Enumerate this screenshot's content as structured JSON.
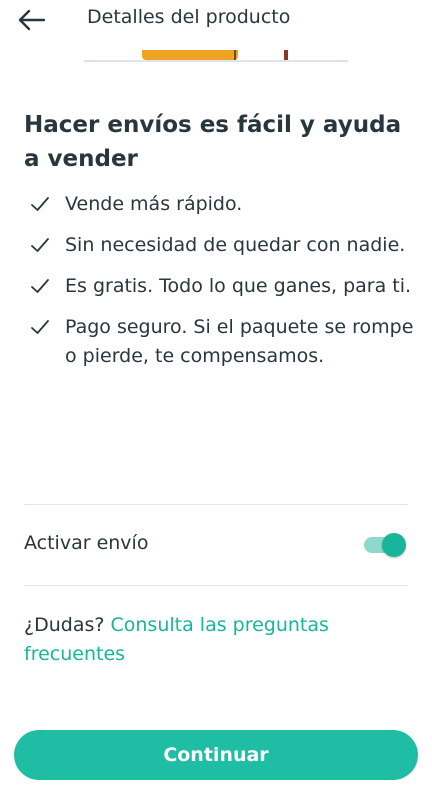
{
  "header": {
    "title": "Detalles del producto",
    "back_icon": "arrow-left-icon"
  },
  "main": {
    "heading": "Hacer envíos es fácil y ayuda a vender",
    "benefits": [
      {
        "icon": "check-icon",
        "text": "Vende más rápido."
      },
      {
        "icon": "check-icon",
        "text": "Sin necesidad de quedar con nadie."
      },
      {
        "icon": "check-icon",
        "text": "Es gratis. Todo lo que ganes, para ti."
      },
      {
        "icon": "check-icon",
        "text": "Pago seguro. Si el paquete se rompe o pierde, te compensamos."
      }
    ],
    "shipping_toggle": {
      "label": "Activar envío",
      "enabled": true
    },
    "faq": {
      "prefix": "¿Dudas?",
      "link": "Consulta las preguntas frecuentes"
    }
  },
  "footer": {
    "continue_label": "Continuar"
  },
  "colors": {
    "accent": "#17b59b",
    "button": "#1fbda4",
    "text": "#29363d",
    "divider": "#e6e9ea"
  }
}
